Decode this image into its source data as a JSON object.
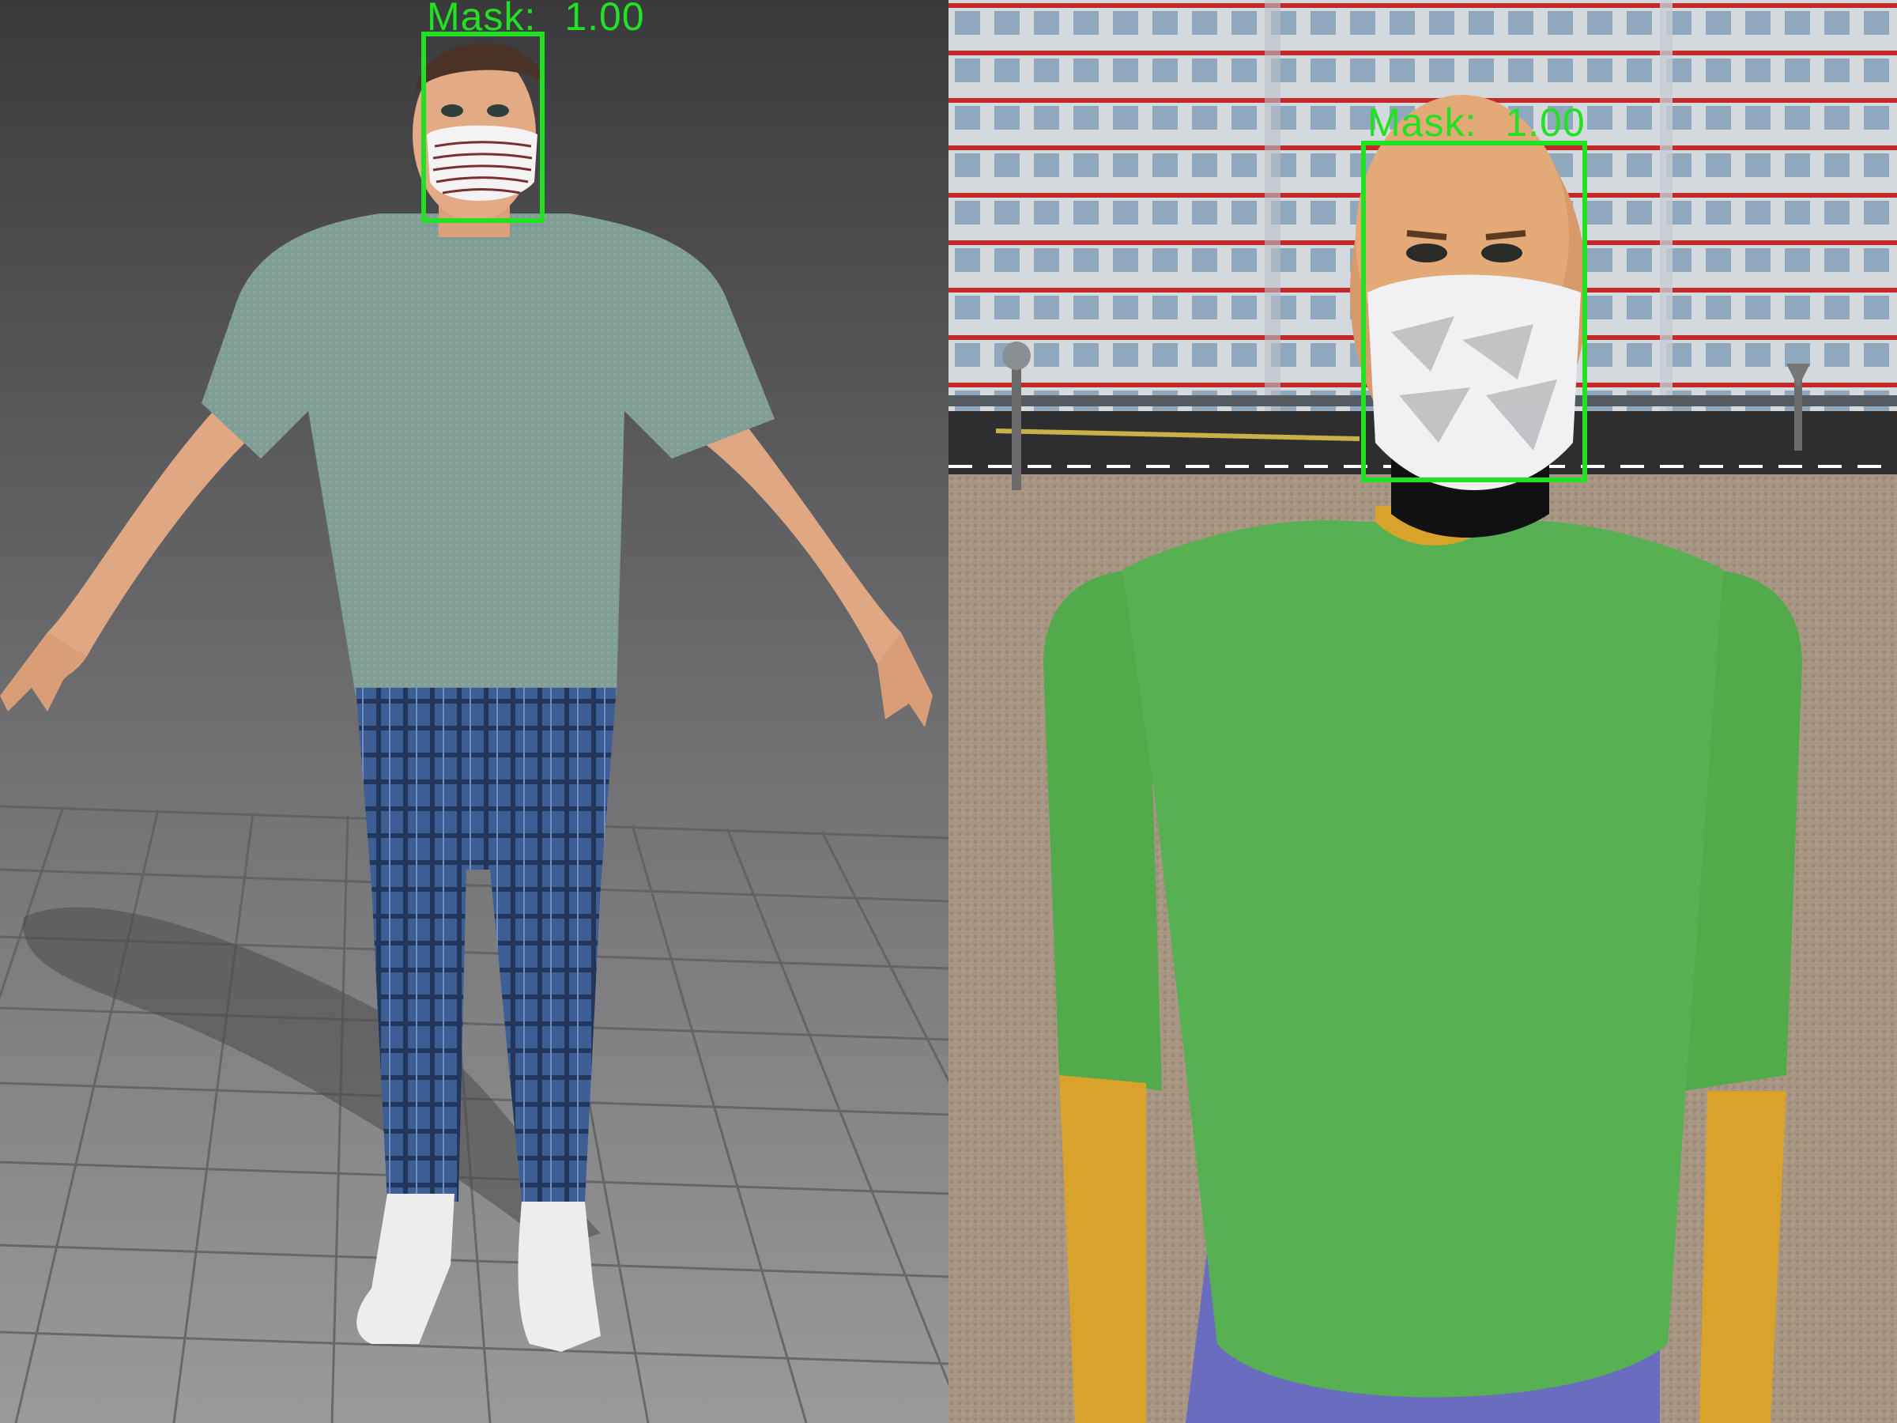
{
  "panels": [
    {
      "detection": {
        "label": "Mask:",
        "score": "1.00",
        "box_color": "#22e022"
      }
    },
    {
      "detection": {
        "label": "Mask:",
        "score": "1.00",
        "box_color": "#22e022"
      }
    }
  ]
}
